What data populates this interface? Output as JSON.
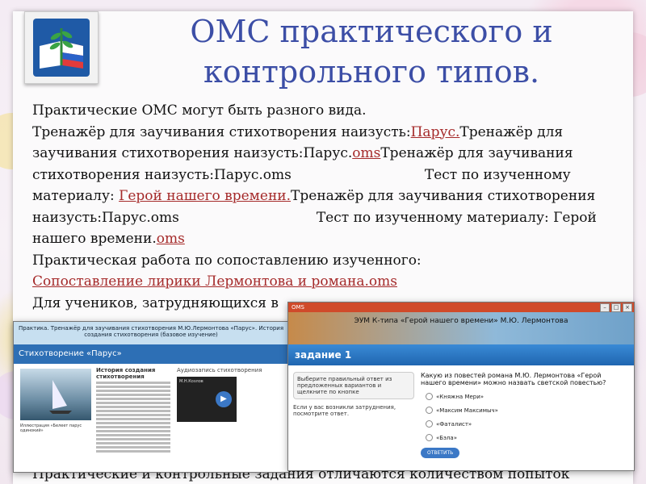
{
  "slide": {
    "title_line1": "ОМС практического и",
    "title_line2": "контрольного типов.",
    "lines": [
      "Практические ОМС могут быть разного вида.",
      "Тренажёр для заучивания стихотворения наизусть:",
      "Парус.",
      "Тренажёр для",
      "заучивания стихотворения наизусть:Парус.",
      "oms",
      "Тренажёр для заучивания",
      "стихотворения наизусть:Парус.oms",
      "Тест по изученному",
      "материалу: ",
      "Герой нашего времени.",
      "Тренажёр для заучивания стихотворения",
      "наизусть:Парус.oms",
      "Тест по изученному материалу: Герой",
      "нашего времени.",
      "oms",
      "Практическая работа по сопоставлению изученного:",
      "Сопоставление лирики Лермонтова и романа.oms",
      "Для учеников, затрудняющихся в",
      "Практические и контрольные задания отличаются количеством попыток"
    ]
  },
  "window1": {
    "title": "",
    "banner": "Практика. Тренажёр для заучивания стихотворения М.Ю.Лермонтова «Парус». История создания стихотворения (базовое изучение)",
    "bluebar": "Стихотворение «Парус»",
    "history_title": "История создания стихотворения",
    "audio_title": "Аудиозапись стихотворения",
    "pic_caption": "Иллюстрация «Белеет парус одинокий»",
    "audio_caption": "М.Н.Козлов"
  },
  "window2": {
    "title": "ОМS",
    "banner": "ЭУМ К-типа «Герой нашего времени» М.Ю. Лермонтова",
    "task": "задание 1",
    "instruction": "Выберите правильный ответ из предложенных вариантов и щелкните по кнопке",
    "hint": "Если у вас возникли затруднения, посмотрите ответ.",
    "question": "Какую из повестей романа М.Ю. Лермонтова «Герой нашего времени» можно назвать светской повестью?",
    "options": [
      "«Княжна Мери»",
      "«Максим Максимыч»",
      "«Фаталист»",
      "«Бэла»"
    ],
    "answer_button": "ОТВЕТИТЬ"
  },
  "colors": {
    "title": "#3c4ea6",
    "link": "#a52a2a",
    "accent": "#2d6fb5"
  }
}
